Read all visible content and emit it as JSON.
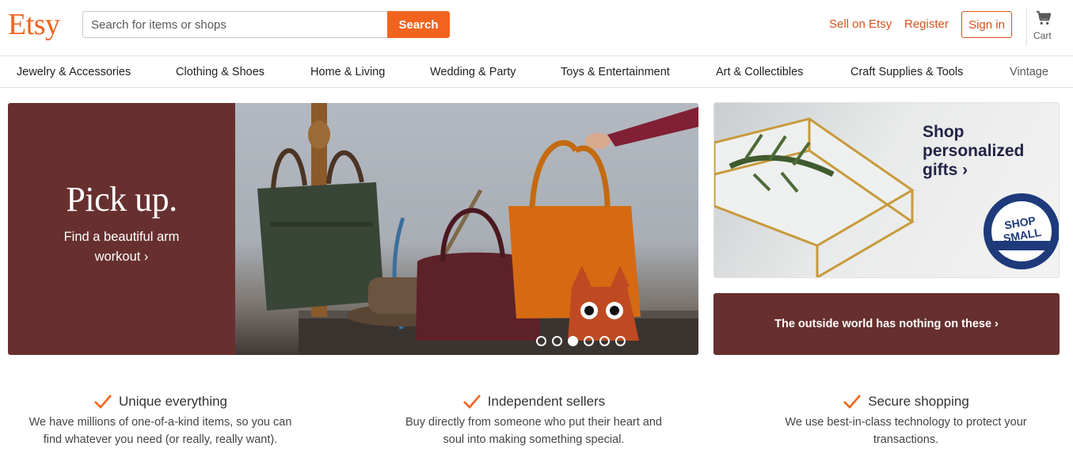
{
  "header": {
    "logo": "Etsy",
    "search_placeholder": "Search for items or shops",
    "search_button": "Search",
    "sell_link": "Sell on Etsy",
    "register_link": "Register",
    "signin_button": "Sign in",
    "cart_label": "Cart"
  },
  "categories": [
    "Jewelry & Accessories",
    "Clothing & Shoes",
    "Home & Living",
    "Wedding & Party",
    "Toys & Entertainment",
    "Art & Collectibles",
    "Craft Supplies & Tools",
    "Vintage"
  ],
  "hero": {
    "title": "Pick up.",
    "subtitle": "Find a beautiful arm workout ›",
    "slides_total": 6,
    "active_slide": 3
  },
  "promo_personalized": {
    "title": "Shop personalized gifts ›",
    "badge": "SHOP SMALL"
  },
  "promo_outside": {
    "text": "The outside world has nothing on these ›"
  },
  "value_props": [
    {
      "title": "Unique everything",
      "body": "We have millions of one-of-a-kind items, so you can find whatever you need (or really, really want)."
    },
    {
      "title": "Independent sellers",
      "body": "Buy directly from someone who put their heart and soul into making something special."
    },
    {
      "title": "Secure shopping",
      "body": "We use best-in-class technology to protect your transactions."
    }
  ],
  "colors": {
    "brand_orange": "#f1641e",
    "link_orange": "#d5521b",
    "hero_maroon": "#67302f",
    "promo_navy": "#232347"
  }
}
